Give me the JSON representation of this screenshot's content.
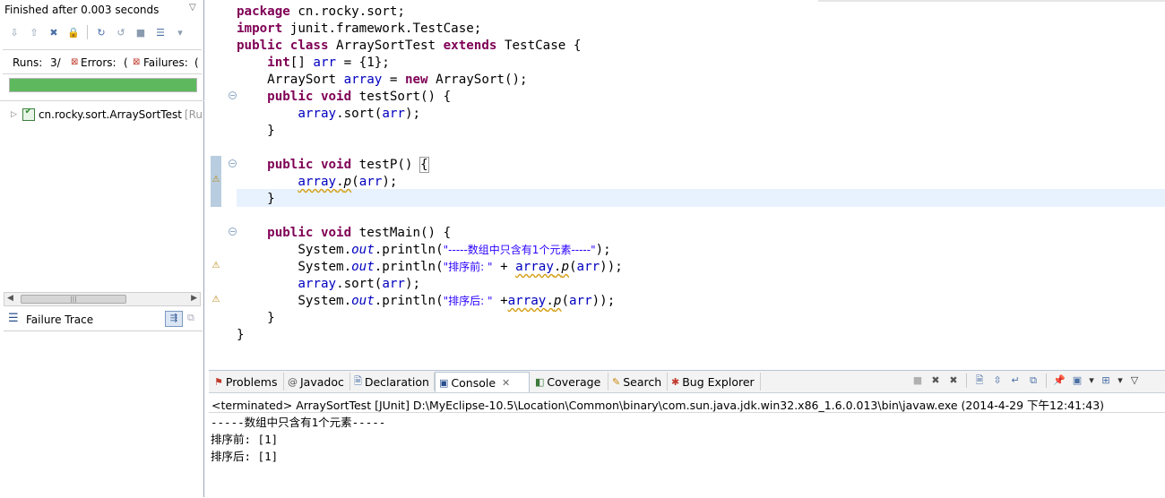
{
  "junit": {
    "status": "Finished after 0.003 seconds",
    "runs_label": "Runs:",
    "runs_value": "3/",
    "errors_label": "Errors:",
    "errors_value": "(",
    "failures_label": "Failures:",
    "failures_value": "(",
    "progress_fraction": 1.0,
    "progress_color": "#5eb95e",
    "tree_item": "cn.rocky.sort.ArraySortTest",
    "tree_item_suffix": "[Ru",
    "failure_trace_label": "Failure Trace"
  },
  "editor": {
    "lines": {
      "l1_kw": "package",
      "l1_rest": " cn.rocky.sort;",
      "l2_kw": "import",
      "l2_rest": " junit.framework.TestCase;",
      "l3_kw1": "public",
      "l3_kw2": "class",
      "l3_name": " ArraySortTest ",
      "l3_kw3": "extends",
      "l3_rest": " TestCase {",
      "l4_kw": "int",
      "l4_a": "[] ",
      "l4_fld": "arr",
      "l4_rest": " = {1};",
      "l5_a": "ArraySort ",
      "l5_fld": "array",
      "l5_b": " = ",
      "l5_kw": "new",
      "l5_rest": " ArraySort();",
      "l6_kw1": "public",
      "l6_kw2": "void",
      "l6_rest": " testSort() {",
      "l7_fld1": "array",
      "l7_a": ".sort(",
      "l7_fld2": "arr",
      "l7_rest": ");",
      "l8": "}",
      "l10_kw1": "public",
      "l10_kw2": "void",
      "l10_rest": " testP() ",
      "l10_brace": "{",
      "l11_fld1": "array",
      "l11_dot": ".",
      "l11_it": "p",
      "l11_a": "(",
      "l11_fld2": "arr",
      "l11_rest": ");",
      "l12": "}",
      "l14_kw1": "public",
      "l14_kw2": "void",
      "l14_rest": " testMain() {",
      "l15_a": "System.",
      "l15_st": "out",
      "l15_b": ".println(",
      "l15_str": "\"-----数组中只含有1个元素-----\"",
      "l15_rest": ");",
      "l16_a": "System.",
      "l16_st": "out",
      "l16_b": ".println(",
      "l16_str": "\"排序前: \"",
      "l16_c": " + ",
      "l16_fld1": "array",
      "l16_dot": ".",
      "l16_it": "p",
      "l16_d": "(",
      "l16_fld2": "arr",
      "l16_rest": "));",
      "l17_fld1": "array",
      "l17_a": ".sort(",
      "l17_fld2": "arr",
      "l17_rest": ");",
      "l18_a": "System.",
      "l18_st": "out",
      "l18_b": ".println(",
      "l18_str": "\"排序后: \"",
      "l18_c": " +",
      "l18_fld1": "array",
      "l18_dot": ".",
      "l18_it": "p",
      "l18_d": "(",
      "l18_fld2": "arr",
      "l18_rest": "));",
      "l19": "}",
      "l20": "}"
    }
  },
  "bottom": {
    "tabs": {
      "problems": "Problems",
      "javadoc": "Javadoc",
      "declaration": "Declaration",
      "console": "Console",
      "coverage": "Coverage",
      "search": "Search",
      "bug_explorer": "Bug Explorer"
    },
    "console_header": "<terminated> ArraySortTest [JUnit] D:\\MyEclipse-10.5\\Location\\Common\\binary\\com.sun.java.jdk.win32.x86_1.6.0.013\\bin\\javaw.exe (2014-4-29 下午12:41:43)",
    "output": {
      "line1": "-----数组中只含有1个元素-----",
      "line2": "排序前: [1]",
      "line3": "排序后: [1]"
    }
  }
}
